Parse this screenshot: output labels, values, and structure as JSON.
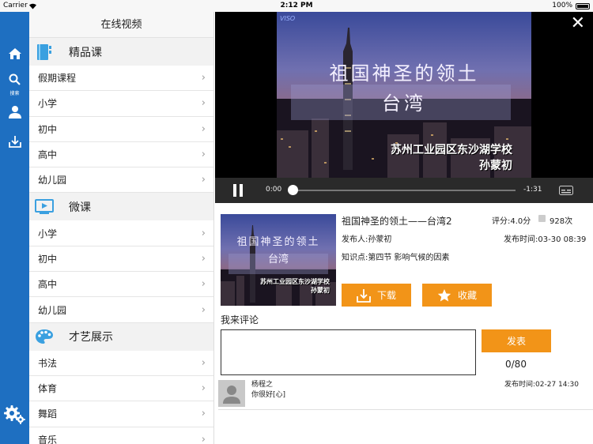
{
  "status_bar": {
    "carrier": "Carrier",
    "time": "2:12 PM",
    "battery": "100%"
  },
  "rail": {
    "search_label": "搜索"
  },
  "sidebar": {
    "title": "在线视频",
    "sections": [
      {
        "title": "精品课",
        "items": [
          "假期课程",
          "小学",
          "初中",
          "高中",
          "幼儿园"
        ]
      },
      {
        "title": "微课",
        "items": [
          "小学",
          "初中",
          "高中",
          "幼儿园"
        ]
      },
      {
        "title": "才艺展示",
        "items": [
          "书法",
          "体育",
          "舞蹈",
          "音乐"
        ]
      }
    ]
  },
  "player": {
    "overlay_title_1": "祖国神圣的领土",
    "overlay_title_2": "台湾",
    "overlay_school": "苏州工业园区东沙湖学校",
    "overlay_teacher": "孙蒙初",
    "corner_logo": "VISO",
    "time_elapsed": "0:00",
    "time_remaining": "-1:31",
    "progress": 0.0
  },
  "detail": {
    "title": "祖国神圣的领土——台湾2",
    "rating": "评分:4.0分",
    "views": "928次",
    "publisher": "发布人:孙蒙初",
    "publish_time": "发布时间:03-30 08:39",
    "knowledge_point": "知识点:第四节 影响气候的因素",
    "download_label": "下载",
    "favorite_label": "收藏",
    "comment_heading": "我来评论",
    "comment_placeholder": "",
    "submit_label": "发表",
    "char_count": "0/80",
    "thumb_title_1": "祖国神圣的领土",
    "thumb_title_2": "台湾",
    "thumb_school": "苏州工业园区东沙湖学校",
    "thumb_teacher": "孙蒙初"
  },
  "comments": [
    {
      "user": "杨程之",
      "text": "你很好[心]",
      "time": "发布时间:02-27 14:30"
    }
  ],
  "colors": {
    "rail": "#1e6fc1",
    "accent_orange": "#f29418",
    "sidebar_header_bg": "#f2f2f2"
  }
}
